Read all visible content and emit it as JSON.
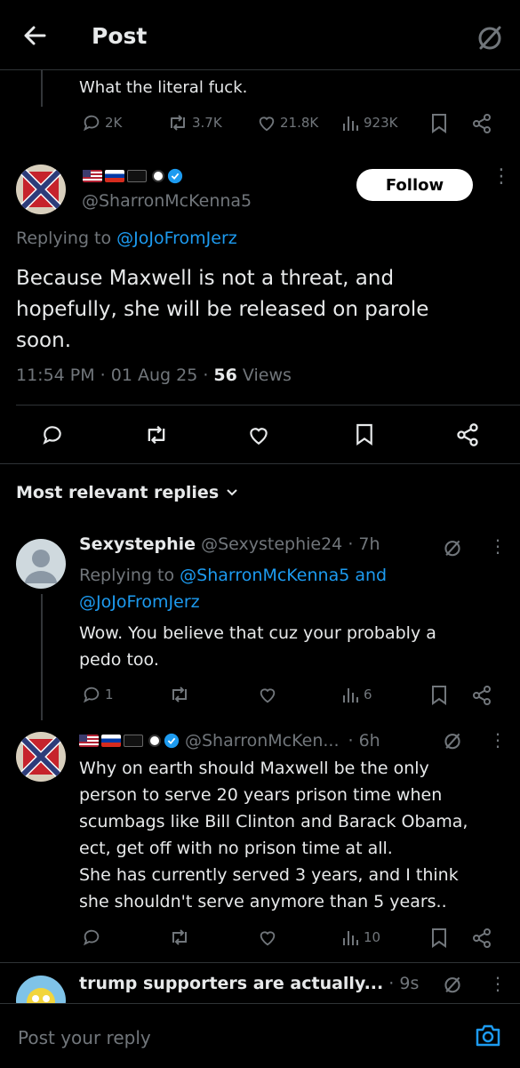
{
  "header": {
    "title": "Post",
    "back_icon": "arrow-left-icon",
    "grok_icon": "grok-icon"
  },
  "top_reply": {
    "text": "What the literal fuck.",
    "stats": {
      "replies": "2K",
      "reposts": "3.7K",
      "likes": "21.8K",
      "views": "923K"
    }
  },
  "main_post": {
    "handle": "@SharronMcKenna5",
    "follow_label": "Follow",
    "replying_prefix": "Replying to ",
    "replying_to": "@JoJoFromJerz",
    "text": "Because Maxwell is not a threat, and hopefully, she will be released on parole soon.",
    "time": "11:54 PM · 01 Aug 25 · ",
    "views_count": "56",
    "views_label": " Views"
  },
  "sort_label": "Most relevant replies",
  "replies": [
    {
      "name": "Sexystephie",
      "handle": "@Sexystephie24",
      "age": "· 7h",
      "replying_prefix": "Replying to ",
      "replying_to_1": "@SharronMcKenna5",
      "replying_and": " and",
      "replying_to_2": "@JoJoFromJerz",
      "text": "Wow. You believe that cuz your probably a pedo too.",
      "reply_count": "1",
      "views": "6"
    },
    {
      "handle": "@SharronMcKen...",
      "age": "· 6h",
      "text_lines": [
        "Why on earth should Maxwell be the only",
        "person to serve 20 years prison time when",
        "scumbags like Bill Clinton and Barack Obama,",
        "ect, get off with no prison time at all.",
        "She has currently served 3 years, and I think",
        "she shouldn't serve anymore than 5 years.."
      ],
      "views": "10"
    },
    {
      "name": "trump supporters are actually...",
      "age": "· 9s"
    }
  ],
  "compose": {
    "placeholder": "Post your reply"
  },
  "colors": {
    "accent": "#1d9bf0",
    "muted": "#71767b",
    "background": "#000000"
  }
}
